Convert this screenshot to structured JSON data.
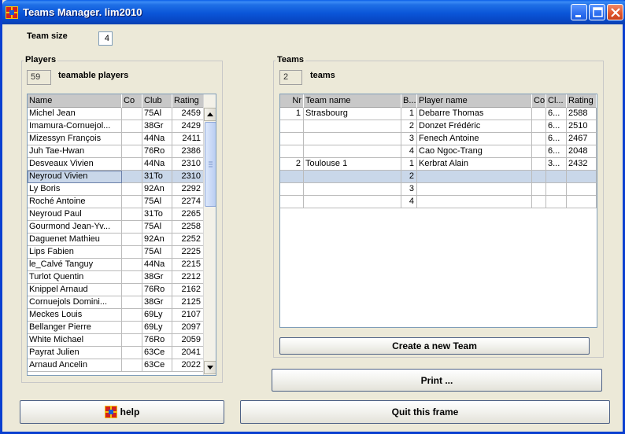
{
  "window": {
    "title": "Teams Manager.  lim2010",
    "minimize_icon": "minimize-icon",
    "maximize_icon": "maximize-icon",
    "close_icon": "close-icon"
  },
  "team_size": {
    "label": "Team size",
    "value": "4"
  },
  "players": {
    "group_title": "Players",
    "count": "59",
    "count_label": "teamable players",
    "columns": [
      "Name",
      "Co",
      "Club",
      "Rating"
    ],
    "selected_index": 5,
    "rows": [
      [
        "Michel Jean",
        "",
        "75Al",
        "2459"
      ],
      [
        "Imamura-Cornuejol...",
        "",
        "38Gr",
        "2429"
      ],
      [
        "Mizessyn François",
        "",
        "44Na",
        "2411"
      ],
      [
        "Juh Tae-Hwan",
        "",
        "76Ro",
        "2386"
      ],
      [
        "Desveaux Vivien",
        "",
        "44Na",
        "2310"
      ],
      [
        "Neyroud Vivien",
        "",
        "31To",
        "2310"
      ],
      [
        "Ly Boris",
        "",
        "92An",
        "2292"
      ],
      [
        "Roché Antoine",
        "",
        "75Al",
        "2274"
      ],
      [
        "Neyroud Paul",
        "",
        "31To",
        "2265"
      ],
      [
        "Gourmond Jean-Yv...",
        "",
        "75Al",
        "2258"
      ],
      [
        "Daguenet Mathieu",
        "",
        "92An",
        "2252"
      ],
      [
        "Lips Fabien",
        "",
        "75Al",
        "2225"
      ],
      [
        "le_Calvé Tanguy",
        "",
        "44Na",
        "2215"
      ],
      [
        "Turlot Quentin",
        "",
        "38Gr",
        "2212"
      ],
      [
        "Knippel Arnaud",
        "",
        "76Ro",
        "2162"
      ],
      [
        "Cornuejols Domini...",
        "",
        "38Gr",
        "2125"
      ],
      [
        "Meckes Louis",
        "",
        "69Ly",
        "2107"
      ],
      [
        "Bellanger Pierre",
        "",
        "69Ly",
        "2097"
      ],
      [
        "White Michael",
        "",
        "76Ro",
        "2059"
      ],
      [
        "Payrat Julien",
        "",
        "63Ce",
        "2041"
      ],
      [
        "Arnaud Ancelin",
        "",
        "63Ce",
        "2022"
      ]
    ]
  },
  "teams": {
    "group_title": "Teams",
    "count": "2",
    "count_label": "teams",
    "columns": [
      "Nr",
      "Team name",
      "B...",
      "Player name",
      "Co",
      "Cl...",
      "Rating"
    ],
    "selected_index": 5,
    "rows": [
      [
        "1",
        "Strasbourg",
        "1",
        "Debarre Thomas",
        "",
        "6...",
        "2588"
      ],
      [
        "",
        "",
        "2",
        "Donzet Frédéric",
        "",
        "6...",
        "2510"
      ],
      [
        "",
        "",
        "3",
        "Fenech Antoine",
        "",
        "6...",
        "2467"
      ],
      [
        "",
        "",
        "4",
        "Cao Ngoc-Trang",
        "",
        "6...",
        "2048"
      ],
      [
        "2",
        "Toulouse 1",
        "1",
        "Kerbrat Alain",
        "",
        "3...",
        "2432"
      ],
      [
        "",
        "",
        "2",
        "",
        "",
        "",
        ""
      ],
      [
        "",
        "",
        "3",
        "",
        "",
        "",
        ""
      ],
      [
        "",
        "",
        "4",
        "",
        "",
        "",
        ""
      ]
    ]
  },
  "buttons": {
    "create_team": "Create a new Team",
    "print": "Print ...",
    "help": "help",
    "quit": "Quit this frame"
  }
}
